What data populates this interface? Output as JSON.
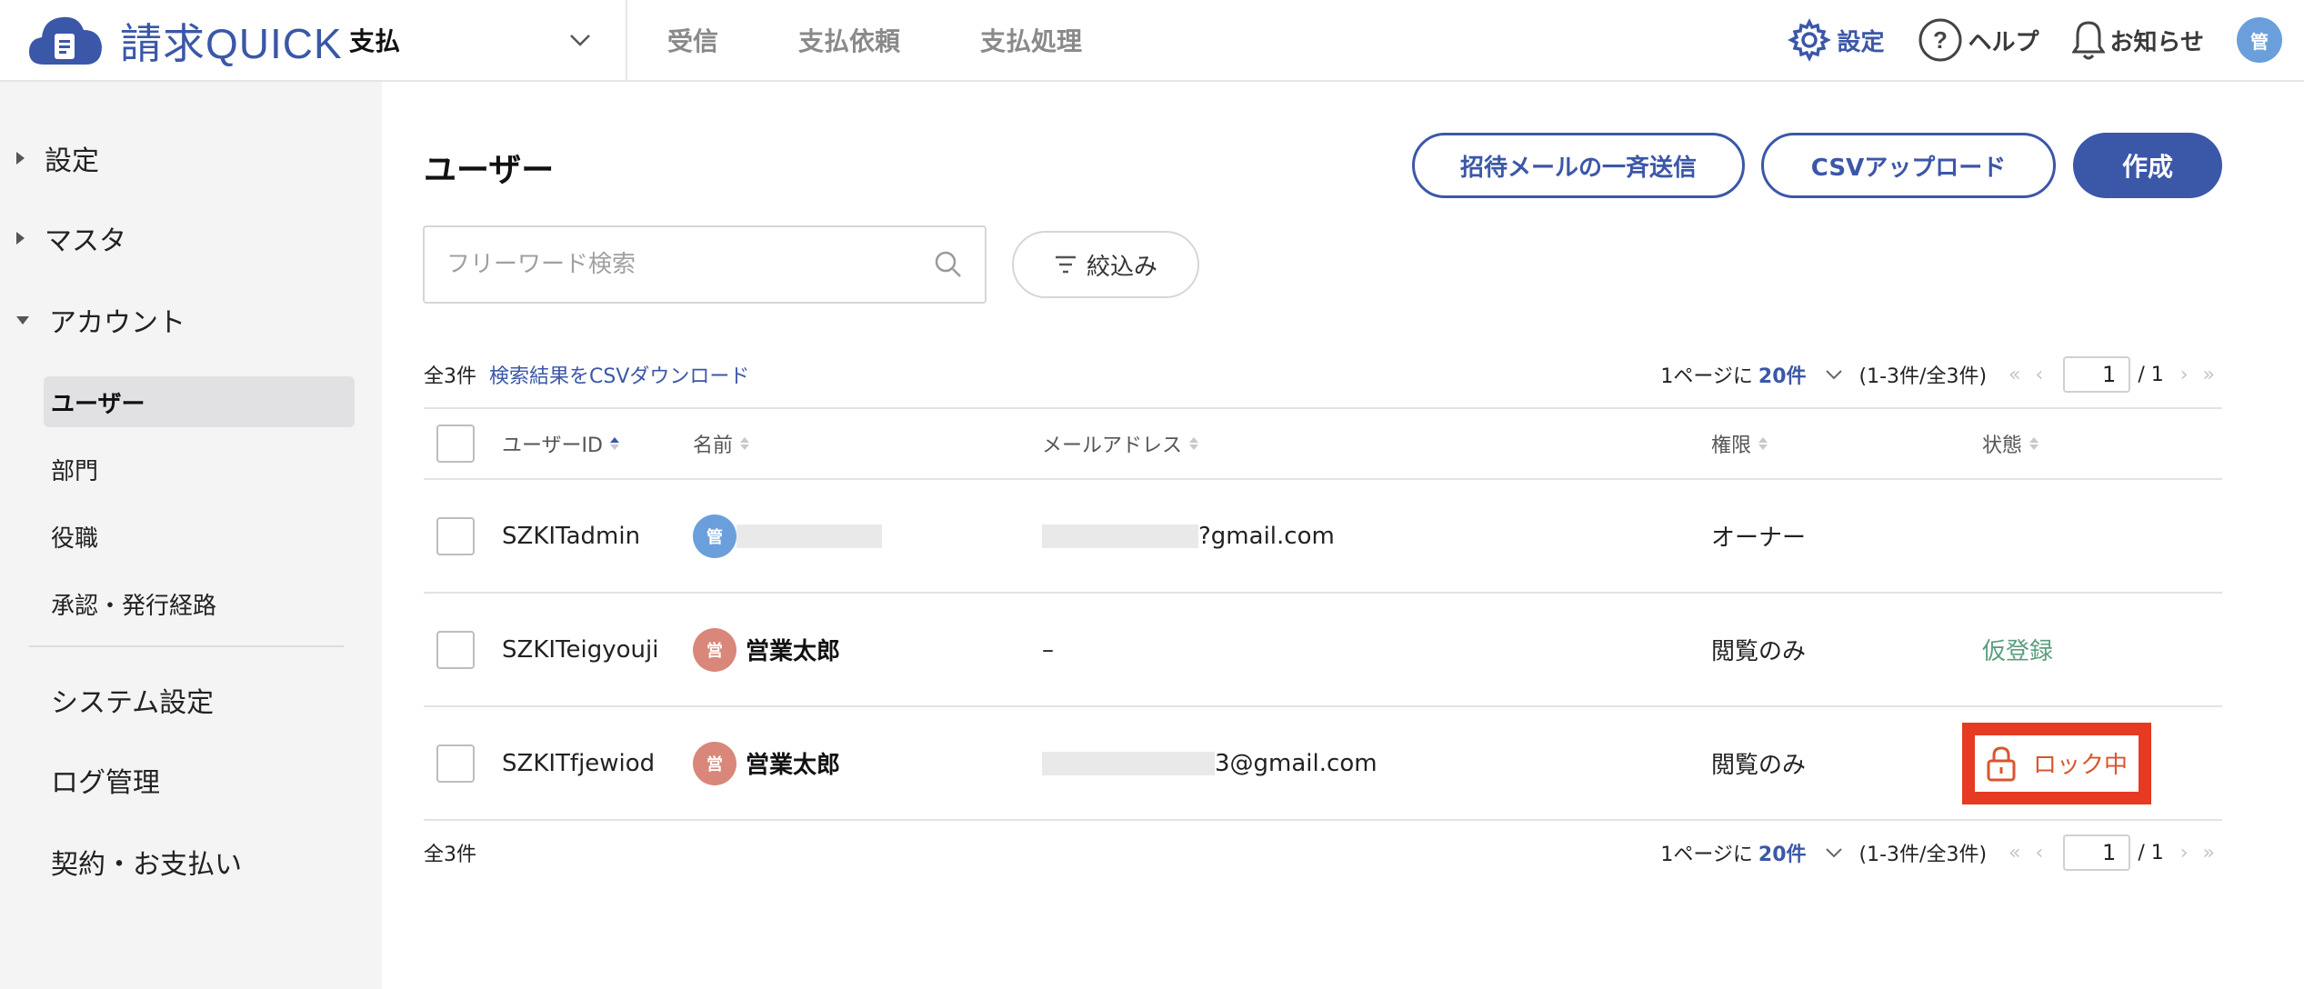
{
  "app": {
    "logo_text_kanji": "請求",
    "logo_text_latin": "QUICK"
  },
  "header": {
    "mode": "支払",
    "nav": [
      "受信",
      "支払依頼",
      "支払処理"
    ],
    "settings_label": "設定",
    "help_label": "ヘルプ",
    "notice_label": "お知らせ",
    "avatar_text": "管"
  },
  "sidebar": {
    "groups": [
      {
        "label": "設定",
        "expanded": false
      },
      {
        "label": "マスタ",
        "expanded": false
      },
      {
        "label": "アカウント",
        "expanded": true
      }
    ],
    "account_items": [
      "ユーザー",
      "部門",
      "役職",
      "承認・発行経路"
    ],
    "active_item": "ユーザー",
    "bottom_items": [
      "システム設定",
      "ログ管理",
      "契約・お支払い"
    ]
  },
  "main": {
    "title": "ユーザー",
    "buttons": {
      "invite": "招待メールの一斉送信",
      "csv_upload": "CSVアップロード",
      "create": "作成"
    },
    "search": {
      "placeholder": "フリーワード検索",
      "value": ""
    },
    "filter_label": "絞込み",
    "summary_top": {
      "count": "全3件",
      "download": "検索結果をCSVダウンロード"
    },
    "summary_bottom": {
      "count": "全3件"
    },
    "pager": {
      "per_page_label": "1ページに",
      "per_page_value": "20件",
      "range": "(1-3件/全3件)",
      "current_page": "1",
      "total_pages": "/ 1"
    },
    "table": {
      "headers": {
        "user_id": "ユーザーID",
        "name": "名前",
        "email": "メールアドレス",
        "role": "権限",
        "status": "状態"
      },
      "rows": [
        {
          "user_id": "SZKITadmin",
          "avatar": "管",
          "avatar_color": "#6a9fdc",
          "name": "",
          "email": "?gmail.com",
          "role": "オーナー",
          "status": ""
        },
        {
          "user_id": "SZKITeigyouji",
          "avatar": "営",
          "avatar_color": "#d9877a",
          "name": "営業太郎",
          "email": "–",
          "role": "閲覧のみ",
          "status": "仮登録"
        },
        {
          "user_id": "SZKITfjewiod",
          "avatar": "営",
          "avatar_color": "#d9877a",
          "name": "営業太郎",
          "email": "3@gmail.com",
          "role": "閲覧のみ",
          "status": "ロック中"
        }
      ]
    }
  },
  "colors": {
    "brand": "#3b57a8",
    "pending": "#5a9e7d",
    "locked": "#d9552e",
    "highlight": "#e63a22"
  }
}
